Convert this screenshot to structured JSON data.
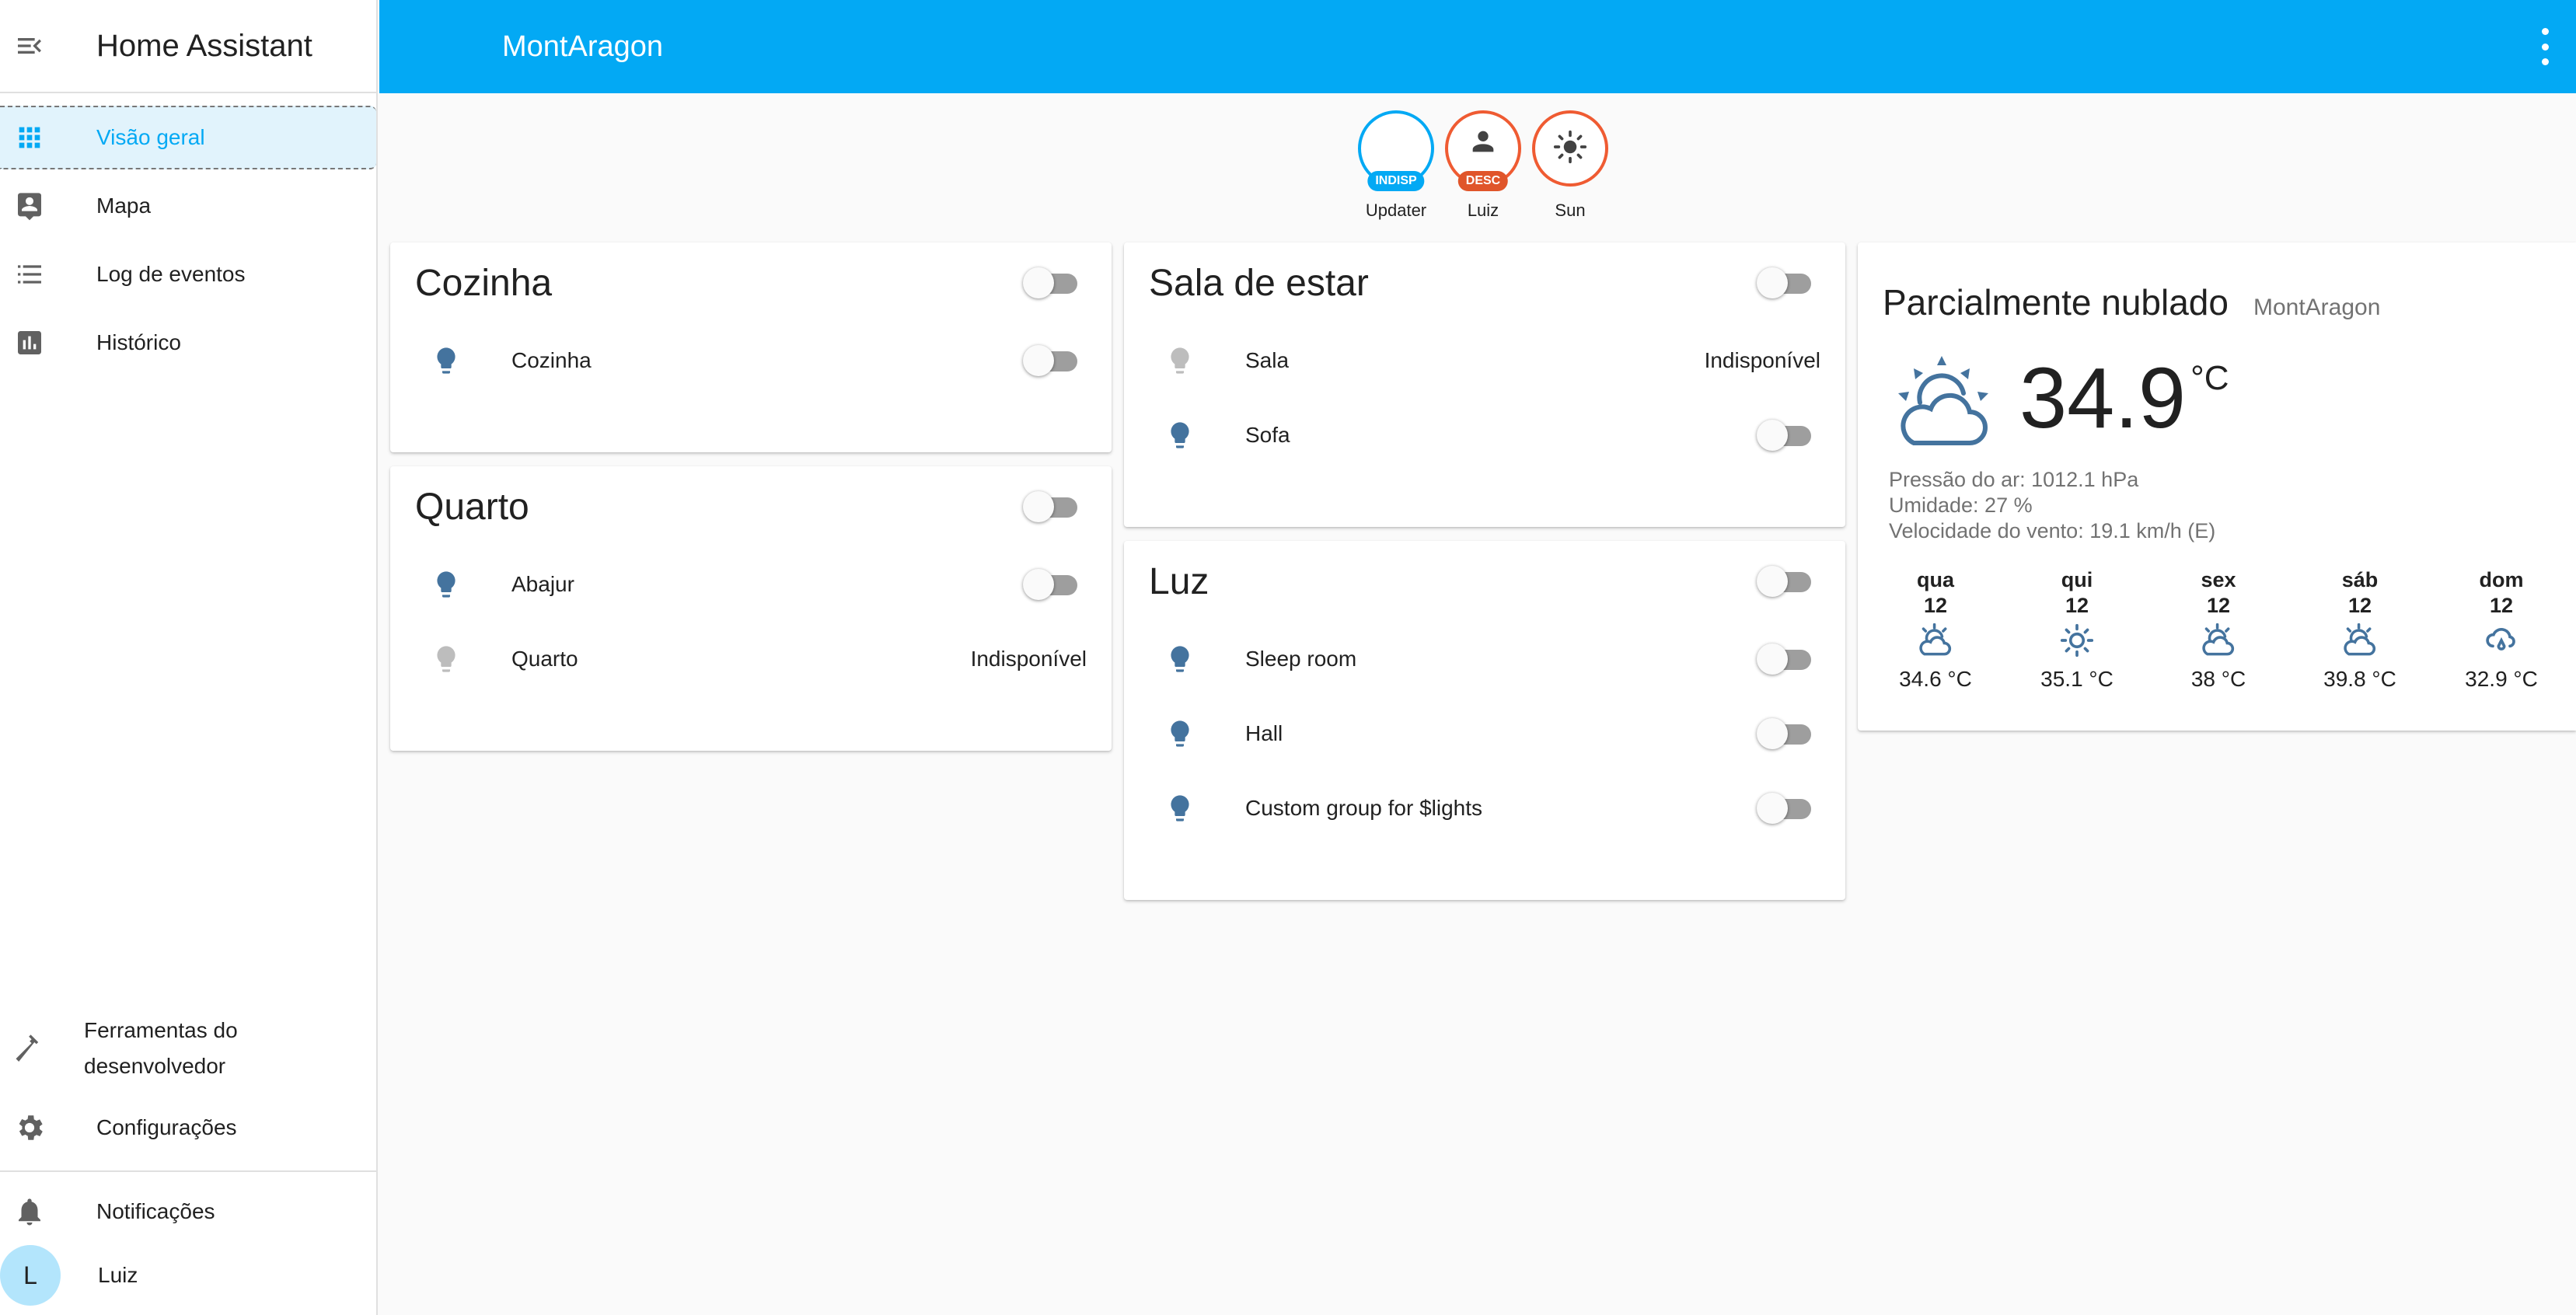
{
  "sidebar": {
    "title": "Home Assistant",
    "items": [
      {
        "label": "Visão geral",
        "icon": "grid-icon",
        "active": true
      },
      {
        "label": "Mapa",
        "icon": "map-account-icon"
      },
      {
        "label": "Log de eventos",
        "icon": "list-icon"
      },
      {
        "label": "Histórico",
        "icon": "chart-bar-icon"
      }
    ],
    "developer_tools": "Ferramentas do desenvolvedor",
    "settings": "Configurações",
    "notifications": "Notificações",
    "user": {
      "initial": "L",
      "name": "Luiz"
    }
  },
  "toolbar": {
    "title": "MontAragon"
  },
  "badges": [
    {
      "name": "Updater",
      "state": "INDISP"
    },
    {
      "name": "Luiz",
      "state": "DESC"
    },
    {
      "name": "Sun"
    }
  ],
  "cards": {
    "cozinha": {
      "title": "Cozinha",
      "rows": [
        {
          "label": "Cozinha"
        }
      ]
    },
    "quarto": {
      "title": "Quarto",
      "rows": [
        {
          "label": "Abajur"
        },
        {
          "label": "Quarto",
          "state": "Indisponível"
        }
      ]
    },
    "sala": {
      "title": "Sala de estar",
      "rows": [
        {
          "label": "Sala",
          "state": "Indisponível"
        },
        {
          "label": "Sofa"
        }
      ]
    },
    "luz": {
      "title": "Luz",
      "rows": [
        {
          "label": "Sleep room"
        },
        {
          "label": "Hall"
        },
        {
          "label": "Custom group for $lights"
        }
      ]
    }
  },
  "weather": {
    "condition": "Parcialmente nublado",
    "location": "MontAragon",
    "temperature": "34.9",
    "unit": "°C",
    "pressure": "Pressão do ar: 1012.1 hPa",
    "humidity": "Umidade: 27 %",
    "wind": "Velocidade do vento: 19.1 km/h (E)",
    "forecast": [
      {
        "day": "qua",
        "date": "12",
        "temp": "34.6 °C",
        "icon": "partly-cloudy-icon"
      },
      {
        "day": "qui",
        "date": "12",
        "temp": "35.1 °C",
        "icon": "sunny-icon"
      },
      {
        "day": "sex",
        "date": "12",
        "temp": "38 °C",
        "icon": "partly-cloudy-icon"
      },
      {
        "day": "sáb",
        "date": "12",
        "temp": "39.8 °C",
        "icon": "partly-cloudy-icon"
      },
      {
        "day": "dom",
        "date": "12",
        "temp": "32.9 °C",
        "icon": "rainy-icon"
      }
    ]
  },
  "colors": {
    "primary": "#03a9f4",
    "badge_orange": "#ef5b32",
    "bulb_on": "#44739e",
    "bulb_unavailable": "#bdbdbd",
    "sidebar_active_bg": "#e1f3fc"
  }
}
